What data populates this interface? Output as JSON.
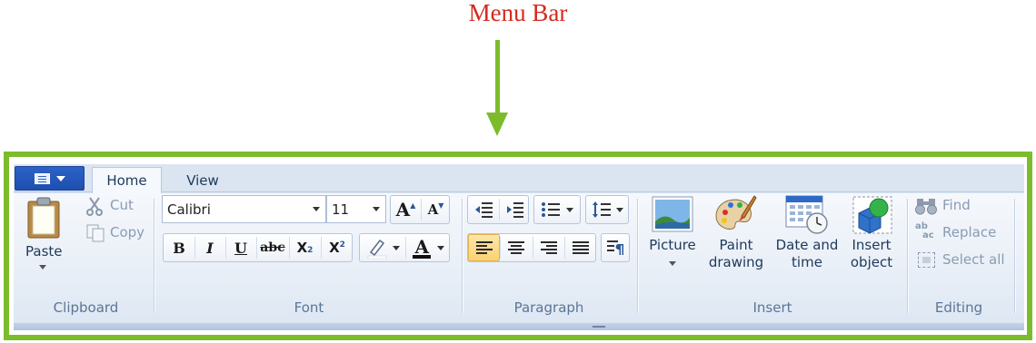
{
  "annotation": {
    "caption": "Menu Bar",
    "caption_color": "#d42a1f",
    "highlight_color": "#7cbc2c"
  },
  "tabs": {
    "home": "Home",
    "view": "View"
  },
  "clipboard": {
    "paste": "Paste",
    "cut": "Cut",
    "copy": "Copy",
    "group": "Clipboard"
  },
  "font": {
    "name": "Calibri",
    "size": "11",
    "group": "Font",
    "bold": "B",
    "italic": "I",
    "underline": "U",
    "strike": "abc",
    "sub": "X",
    "sub_mark": "2",
    "sup": "X",
    "sup_mark": "2",
    "grow": "A",
    "shrink": "A",
    "color_letter": "A"
  },
  "paragraph": {
    "group": "Paragraph"
  },
  "insert": {
    "picture": "Picture",
    "paint_drawing_1": "Paint",
    "paint_drawing_2": "drawing",
    "date_time_1": "Date and",
    "date_time_2": "time",
    "insert_object_1": "Insert",
    "insert_object_2": "object",
    "group": "Insert"
  },
  "editing": {
    "find": "Find",
    "replace": "Replace",
    "select_all": "Select all",
    "group": "Editing",
    "replace_icon_top": "ab",
    "replace_icon_bottom": "ac"
  }
}
